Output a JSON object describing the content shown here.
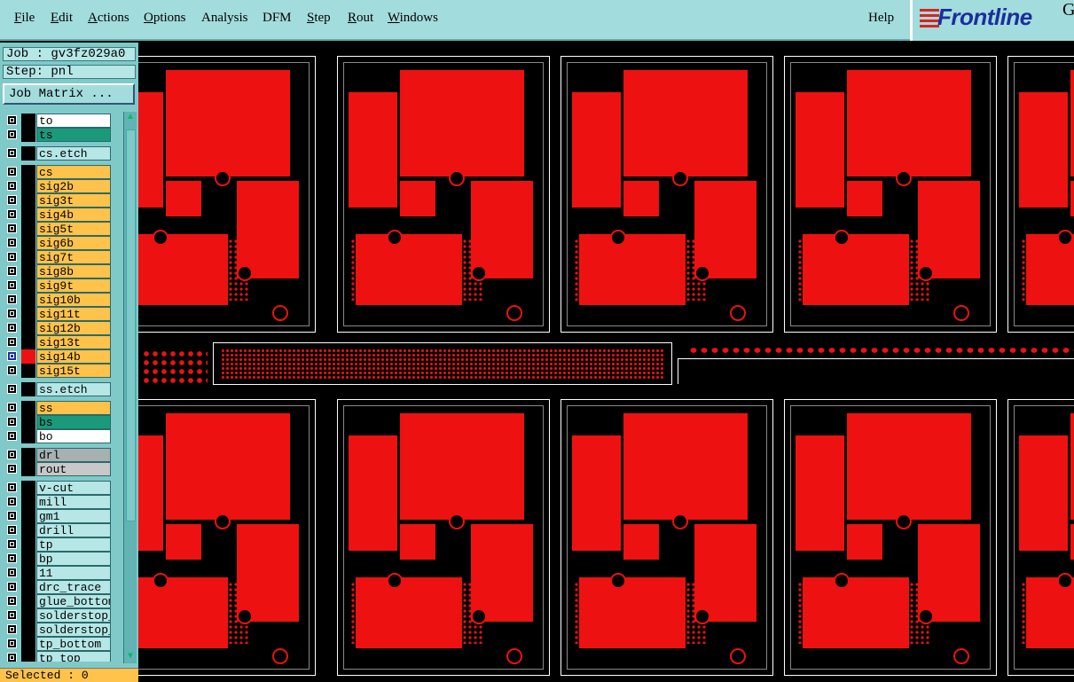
{
  "menubar": {
    "items": [
      {
        "label": "File",
        "ul": "F",
        "rest": "ile"
      },
      {
        "label": "Edit",
        "ul": "E",
        "rest": "dit"
      },
      {
        "label": "Actions",
        "ul": "A",
        "rest": "ctions"
      },
      {
        "label": "Options",
        "ul": "O",
        "rest": "ptions"
      },
      {
        "label": "Analysis",
        "ul": "",
        "rest": "Analysis"
      },
      {
        "label": "DFM",
        "ul": "",
        "rest": "DFM"
      },
      {
        "label": "Step",
        "ul": "S",
        "rest": "tep"
      },
      {
        "label": "Rout",
        "ul": "R",
        "rest": "out"
      },
      {
        "label": "Windows",
        "ul": "W",
        "rest": "indows"
      }
    ],
    "help": "Help"
  },
  "logo": {
    "text": "Frontline",
    "extra": "G"
  },
  "panel": {
    "job": "Job : gv3fz029a0",
    "step": "Step: pnl",
    "job_matrix": "Job Matrix ...",
    "selected": "Selected : 0"
  },
  "layers": [
    {
      "name": "to",
      "color": "#ffffff",
      "group": 0
    },
    {
      "name": "ts",
      "color": "#1a9a7a",
      "group": 0
    },
    {
      "name": "cs.etch",
      "color": "#b6e6e6",
      "group": 1
    },
    {
      "name": "cs",
      "color": "#ffc24a",
      "group": 2
    },
    {
      "name": "sig2b",
      "color": "#ffc24a",
      "group": 2
    },
    {
      "name": "sig3t",
      "color": "#ffc24a",
      "group": 2
    },
    {
      "name": "sig4b",
      "color": "#ffc24a",
      "group": 2
    },
    {
      "name": "sig5t",
      "color": "#ffc24a",
      "group": 2
    },
    {
      "name": "sig6b",
      "color": "#ffc24a",
      "group": 2
    },
    {
      "name": "sig7t",
      "color": "#ffc24a",
      "group": 2
    },
    {
      "name": "sig8b",
      "color": "#ffc24a",
      "group": 2
    },
    {
      "name": "sig9t",
      "color": "#ffc24a",
      "group": 2
    },
    {
      "name": "sig10b",
      "color": "#ffc24a",
      "group": 2
    },
    {
      "name": "sig11t",
      "color": "#ffc24a",
      "group": 2
    },
    {
      "name": "sig12b",
      "color": "#ffc24a",
      "group": 2
    },
    {
      "name": "sig13t",
      "color": "#ffc24a",
      "group": 2
    },
    {
      "name": "sig14b",
      "color": "#ffc24a",
      "group": 2,
      "active": true
    },
    {
      "name": "sig15t",
      "color": "#ffc24a",
      "group": 2
    },
    {
      "name": "ss.etch",
      "color": "#b6e6e6",
      "group": 3
    },
    {
      "name": "ss",
      "color": "#ffc24a",
      "group": 4
    },
    {
      "name": "bs",
      "color": "#1a9a7a",
      "group": 4
    },
    {
      "name": "bo",
      "color": "#ffffff",
      "group": 4
    },
    {
      "name": "drl",
      "color": "#a8b0b0",
      "group": 5
    },
    {
      "name": "rout",
      "color": "#c8c8c8",
      "group": 5
    },
    {
      "name": "v-cut",
      "color": "#b6e6e6",
      "group": 6
    },
    {
      "name": "mill",
      "color": "#b6e6e6",
      "group": 6
    },
    {
      "name": "gm1",
      "color": "#b6e6e6",
      "group": 6
    },
    {
      "name": "drill",
      "color": "#b6e6e6",
      "group": 6
    },
    {
      "name": "tp",
      "color": "#b6e6e6",
      "group": 6
    },
    {
      "name": "bp",
      "color": "#b6e6e6",
      "group": 6
    },
    {
      "name": "11",
      "color": "#b6e6e6",
      "group": 6
    },
    {
      "name": "drc_trace",
      "color": "#b6e6e6",
      "group": 6
    },
    {
      "name": "glue_bottom",
      "color": "#b6e6e6",
      "group": 6
    },
    {
      "name": "solderstop_b",
      "color": "#b6e6e6",
      "group": 6
    },
    {
      "name": "solderstop_t",
      "color": "#b6e6e6",
      "group": 6
    },
    {
      "name": "tp_bottom",
      "color": "#b6e6e6",
      "group": 6
    },
    {
      "name": "tp_top",
      "color": "#b6e6e6",
      "group": 6
    }
  ],
  "colors": {
    "copper": "#ee1111",
    "menubar": "#a3dcdc",
    "panel": "#7fc9c9",
    "signal": "#ffc24a"
  }
}
